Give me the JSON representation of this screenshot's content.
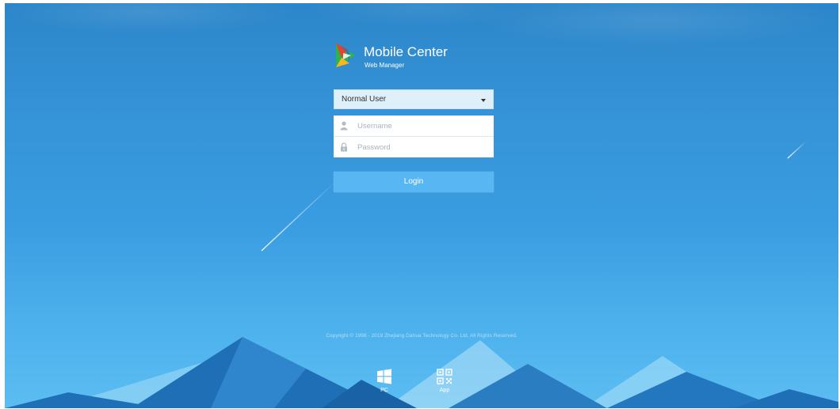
{
  "app": {
    "title": "Mobile Center",
    "subtitle": "Web Manager"
  },
  "login_form": {
    "user_type": {
      "selected": "Normal User"
    },
    "username": {
      "placeholder": "Username",
      "value": ""
    },
    "password": {
      "placeholder": "Password",
      "value": ""
    },
    "login_label": "Login"
  },
  "footer": {
    "copyright": "Copyright © 1998 - 2019 Zhejiang Dahua Technology Co. Ltd. All Rights Reserved.",
    "downloads": [
      {
        "label": "PC",
        "icon": "windows-icon"
      },
      {
        "label": "App",
        "icon": "qr-code-icon"
      }
    ]
  },
  "colors": {
    "sky_top": "#2c86c9",
    "sky_bottom": "#5bbdf1",
    "select_bg": "#dff0fb",
    "login_button": "#58b7f3",
    "mountain_dark": "#1e6fb6",
    "mountain_light": "#8fd3f5"
  }
}
